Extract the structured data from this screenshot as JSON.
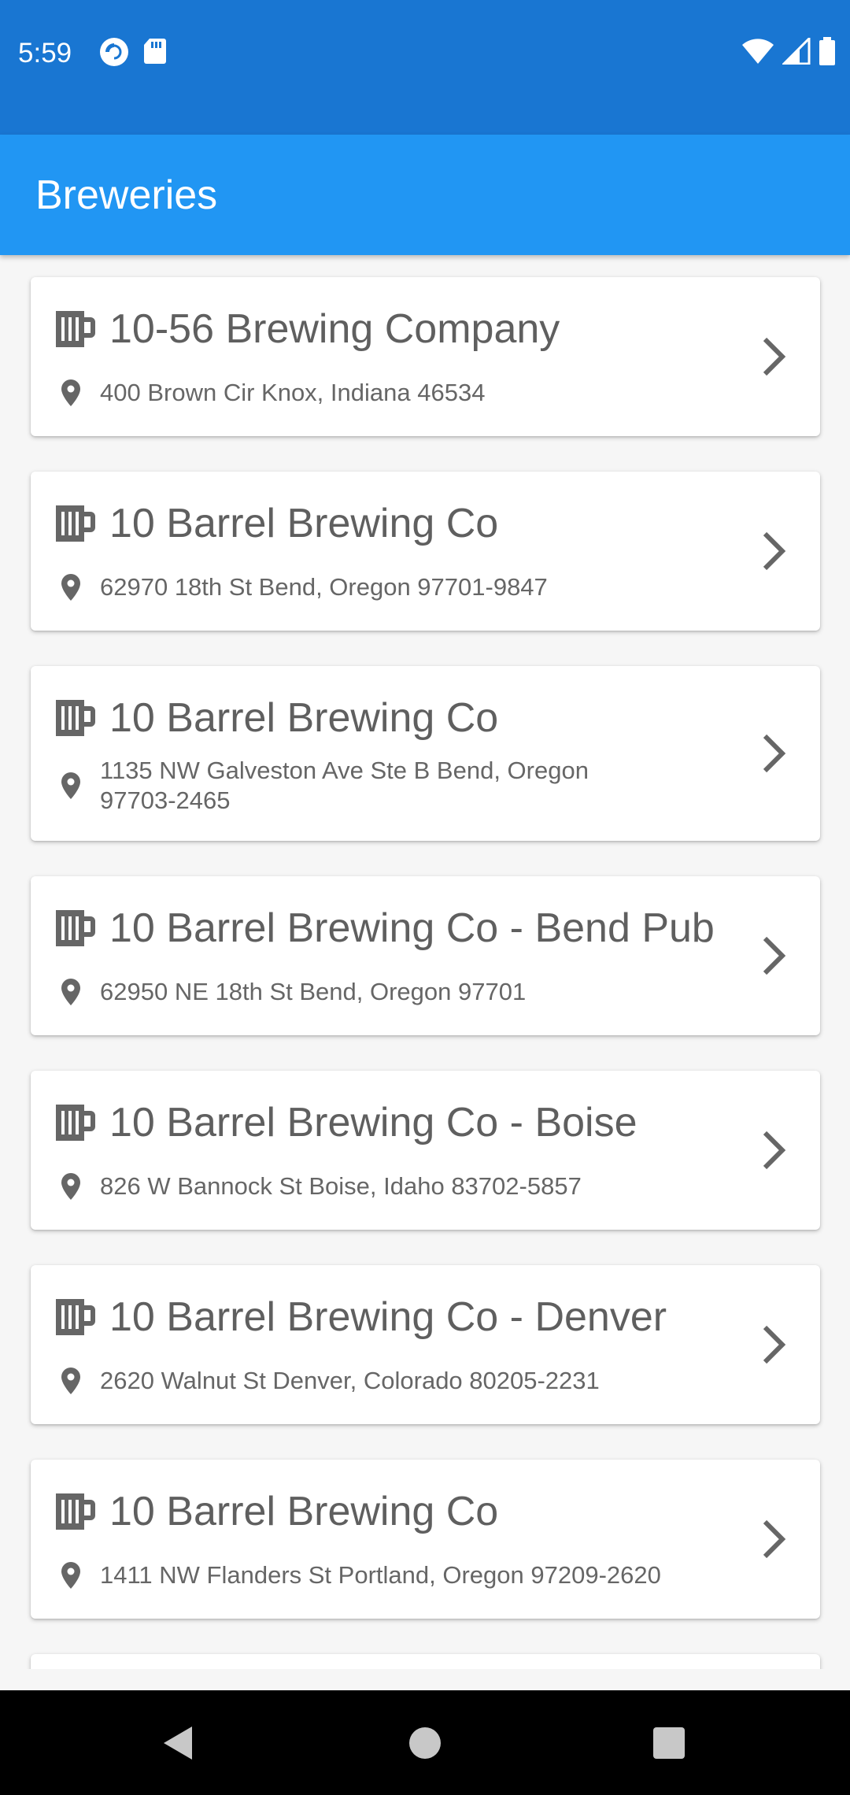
{
  "status_bar": {
    "time": "5:59",
    "icons_left": [
      "pocket-casts-icon",
      "sd-card-icon"
    ],
    "icons_right": [
      "wifi-icon",
      "cellular-signal-icon",
      "battery-icon"
    ]
  },
  "app_bar": {
    "title": "Breweries"
  },
  "breweries": [
    {
      "name": "10-56 Brewing Company",
      "address": "400 Brown Cir Knox, Indiana 46534"
    },
    {
      "name": "10 Barrel Brewing Co",
      "address": "62970 18th St Bend, Oregon 97701-9847"
    },
    {
      "name": "10 Barrel Brewing Co",
      "address": "1135 NW Galveston Ave Ste B Bend, Oregon 97703-2465"
    },
    {
      "name": "10 Barrel Brewing Co - Bend Pub",
      "address": "62950 NE 18th St Bend, Oregon 97701"
    },
    {
      "name": "10 Barrel Brewing Co - Boise",
      "address": "826 W Bannock St Boise, Idaho 83702-5857"
    },
    {
      "name": "10 Barrel Brewing Co - Denver",
      "address": "2620 Walnut St Denver, Colorado 80205-2231"
    },
    {
      "name": "10 Barrel Brewing Co",
      "address": "1411 NW Flanders St Portland, Oregon 97209-2620"
    }
  ],
  "colors": {
    "status_bar": "#1976d2",
    "app_bar": "#2196f3",
    "background": "#f6f6f6",
    "icon_gray": "#666666"
  },
  "nav_bar": {
    "buttons": [
      "back-icon",
      "home-icon",
      "recents-icon"
    ]
  }
}
